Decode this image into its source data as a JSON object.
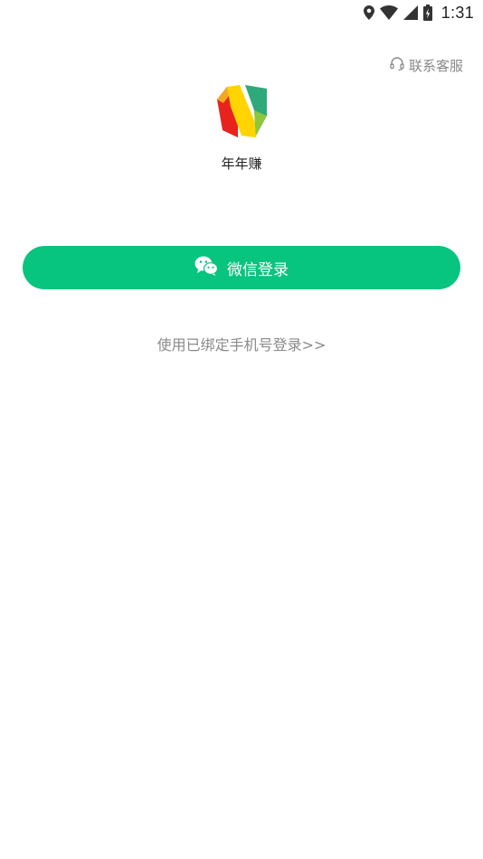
{
  "status_bar": {
    "time": "1:31",
    "icons": [
      "location-icon",
      "wifi-icon",
      "signal-icon",
      "battery-charging-icon"
    ]
  },
  "header": {
    "contact_label": "联系客服",
    "contact_icon": "headset-icon"
  },
  "app": {
    "name": "年年赚",
    "logo_icon": "app-logo-n",
    "logo_colors": [
      "#e8231e",
      "#f5a623",
      "#ffd400",
      "#2eaa7a",
      "#8dc63f"
    ]
  },
  "login": {
    "wechat_label": "微信登录",
    "wechat_icon": "wechat-icon",
    "phone_link_label": "使用已绑定手机号登录>>"
  },
  "colors": {
    "primary_green": "#07c47f",
    "muted_text": "#888888"
  }
}
